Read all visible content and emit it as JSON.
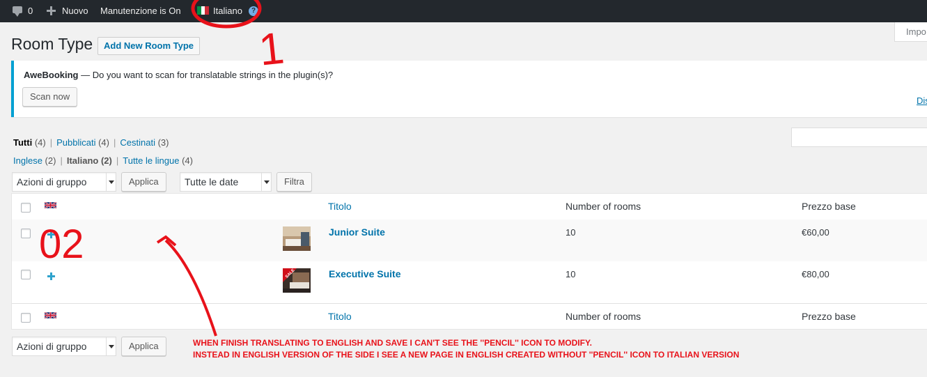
{
  "admin_bar": {
    "comments_count": "0",
    "new_label": "Nuovo",
    "maintenance_label": "Manutenzione is On",
    "language_label": "Italiano",
    "help_icon": "?",
    "flag_colors": [
      "#009246",
      "#ffffff",
      "#ce2b37"
    ]
  },
  "screen_options": {
    "label": "Impo"
  },
  "page": {
    "title": "Room Type",
    "add_new_label": "Add New Room Type"
  },
  "notice": {
    "plugin": "AweBooking",
    "message": " — Do you want to scan for translatable strings in the plugin(s)?",
    "scan_label": "Scan now",
    "dismiss_label": "Dis"
  },
  "status_filter": {
    "all_label": "Tutti",
    "all_count": "(4)",
    "published_label": "Pubblicati",
    "published_count": "(4)",
    "trash_label": "Cestinati",
    "trash_count": "(3)"
  },
  "lang_filter": {
    "english_label": "Inglese",
    "english_count": "(2)",
    "italian_label": "Italiano",
    "italian_count": "(2)",
    "all_langs_label": "Tutte le lingue",
    "all_langs_count": "(4)"
  },
  "bulk_actions": {
    "select_value": "Azioni di gruppo",
    "apply_label": "Applica",
    "date_select_value": "Tutte le date",
    "filter_label": "Filtra"
  },
  "table": {
    "columns": {
      "title": "Titolo",
      "rooms": "Number of rooms",
      "price": "Prezzo base"
    },
    "rows": [
      {
        "title": "Junior Suite",
        "rooms": "10",
        "price": "€60,00"
      },
      {
        "title": "Executive Suite",
        "rooms": "10",
        "price": "€80,00",
        "badge": "SALE"
      }
    ]
  },
  "annotations": {
    "label_1": "1",
    "label_2": "02",
    "note_line_1": "WHEN FINISH TRANSLATING TO ENGLISH AND SAVE I CAN'T SEE THE ''PENCIL'' ICON TO MODIFY.",
    "note_line_2": "INSTEAD IN ENGLISH VERSION OF THE SIDE I SEE A NEW PAGE IN ENGLISH CREATED WITHOUT ''PENCIL'' ICON TO ITALIAN VERSION",
    "color": "#e8121a"
  }
}
